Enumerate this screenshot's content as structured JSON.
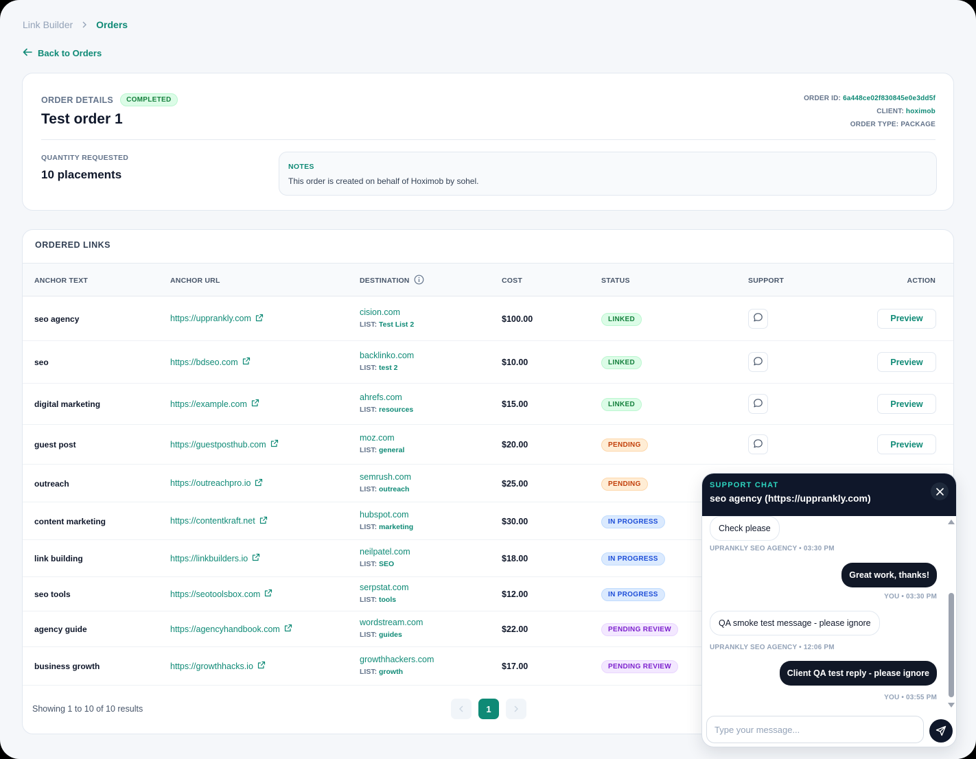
{
  "breadcrumb": {
    "root": "Link Builder",
    "current": "Orders"
  },
  "back_link": "Back to Orders",
  "order": {
    "section_label": "ORDER DETAILS",
    "status_badge": "COMPLETED",
    "title": "Test order 1",
    "id_label": "ORDER ID:",
    "id_value": "6a448ce02f830845e0e3dd5f",
    "client_label": "CLIENT:",
    "client_value": "hoximob",
    "type_label": "ORDER TYPE:",
    "type_value": "PACKAGE",
    "quantity_label": "QUANTITY REQUESTED",
    "quantity_value": "10 placements",
    "notes_label": "NOTES",
    "notes_text": "This order is created on behalf of Hoximob by sohel."
  },
  "links_section": {
    "title": "ORDERED LINKS",
    "columns": [
      "ANCHOR TEXT",
      "ANCHOR URL",
      "DESTINATION",
      "COST",
      "STATUS",
      "SUPPORT",
      "ACTION"
    ],
    "list_label": "LIST:",
    "rows": [
      {
        "anchor": "seo agency",
        "url": "https://upprankly.com",
        "domain": "cision.com",
        "list": "Test List 2",
        "cost": "$100.00",
        "status": "LINKED",
        "action": "Preview"
      },
      {
        "anchor": "seo",
        "url": "https://bdseo.com",
        "domain": "backlinko.com",
        "list": "test 2",
        "cost": "$10.00",
        "status": "LINKED",
        "action": "Preview"
      },
      {
        "anchor": "digital marketing",
        "url": "https://example.com",
        "domain": "ahrefs.com",
        "list": "resources",
        "cost": "$15.00",
        "status": "LINKED",
        "action": "Preview"
      },
      {
        "anchor": "guest post",
        "url": "https://guestposthub.com",
        "domain": "moz.com",
        "list": "general",
        "cost": "$20.00",
        "status": "PENDING",
        "action": "Preview"
      },
      {
        "anchor": "outreach",
        "url": "https://outreachpro.io",
        "domain": "semrush.com",
        "list": "outreach",
        "cost": "$25.00",
        "status": "PENDING"
      },
      {
        "anchor": "content marketing",
        "url": "https://contentkraft.net",
        "domain": "hubspot.com",
        "list": "marketing",
        "cost": "$30.00",
        "status": "IN PROGRESS"
      },
      {
        "anchor": "link building",
        "url": "https://linkbuilders.io",
        "domain": "neilpatel.com",
        "list": "SEO",
        "cost": "$18.00",
        "status": "IN PROGRESS"
      },
      {
        "anchor": "seo tools",
        "url": "https://seotoolsbox.com",
        "domain": "serpstat.com",
        "list": "tools",
        "cost": "$12.00",
        "status": "IN PROGRESS"
      },
      {
        "anchor": "agency guide",
        "url": "https://agencyhandbook.com",
        "domain": "wordstream.com",
        "list": "guides",
        "cost": "$22.00",
        "status": "PENDING REVIEW"
      },
      {
        "anchor": "business growth",
        "url": "https://growthhacks.io",
        "domain": "growthhackers.com",
        "list": "growth",
        "cost": "$17.00",
        "status": "PENDING REVIEW"
      }
    ],
    "footer_text": "Showing 1 to 10 of 10 results",
    "pagination": {
      "current_page": "1",
      "prev_icon": "chevron-left-icon",
      "next_icon": "chevron-right-icon"
    }
  },
  "chat": {
    "kicker": "SUPPORT CHAT",
    "title": "seo agency (https://upprankly.com)",
    "messages": [
      {
        "from": "agency",
        "text": "Check please",
        "meta": "UPRANKLY SEO AGENCY • 03:30 PM"
      },
      {
        "from": "you",
        "text": "Great work, thanks!",
        "meta": "YOU • 03:30 PM"
      },
      {
        "from": "agency",
        "text": "QA smoke test message - please ignore",
        "meta": "UPRANKLY SEO AGENCY • 12:06 PM"
      },
      {
        "from": "you",
        "text": "Client QA test reply - please ignore",
        "meta": "YOU • 03:55 PM"
      }
    ],
    "input_placeholder": "Type your message...",
    "send_icon": "send-icon",
    "close_icon": "close-icon"
  },
  "colors": {
    "accent": "#0f8a76",
    "dark": "#0f172a",
    "linked": "#15803d",
    "pending": "#c2410c",
    "in_progress": "#1d4ed8",
    "pending_review": "#7e22ce"
  }
}
